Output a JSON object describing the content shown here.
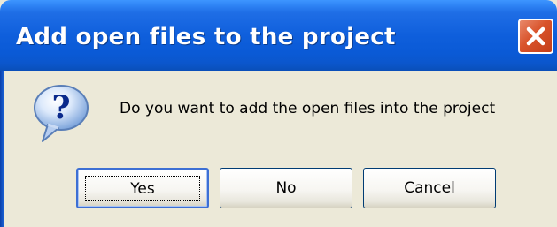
{
  "window": {
    "title": "Add open files to the project"
  },
  "dialog": {
    "icon": "question-icon",
    "message": "Do you want to add the open files into the project"
  },
  "buttons": {
    "yes": "Yes",
    "no": "No",
    "cancel": "Cancel"
  },
  "colors": {
    "titlebar": "#0a5ad6",
    "dialog_bg": "#ece9d8",
    "close_button": "#d9532b",
    "focus_border": "#3d6fd4"
  }
}
